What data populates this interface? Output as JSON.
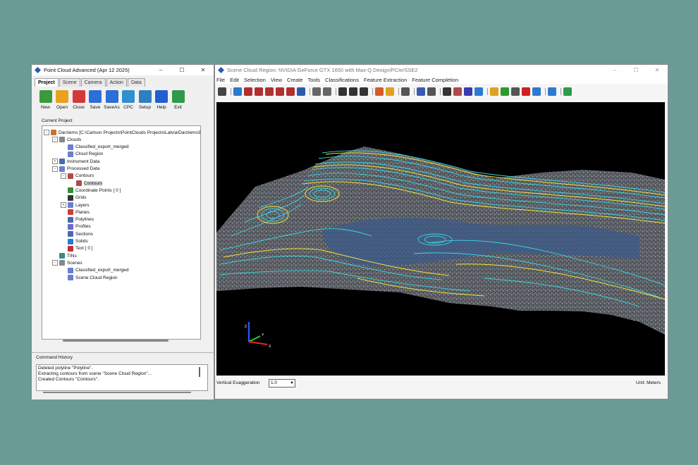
{
  "left_window": {
    "title": "Point Cloud Advanced (Apr 12 2025)",
    "controls": {
      "minimize": "–",
      "maximize": "☐",
      "close": "✕"
    },
    "tabs": [
      "Project",
      "Scene",
      "Camera",
      "Action",
      "Data"
    ],
    "toolbar": [
      {
        "label": "New",
        "icon": "new-icon",
        "color": "#3a9a3a"
      },
      {
        "label": "Open",
        "icon": "open-folder-icon",
        "color": "#e8a21e"
      },
      {
        "label": "Close",
        "icon": "close-doc-icon",
        "color": "#d23a3a"
      },
      {
        "label": "Save",
        "icon": "save-icon",
        "color": "#2c6fd6"
      },
      {
        "label": "SaveAs",
        "icon": "saveas-icon",
        "color": "#2c6fd6"
      },
      {
        "label": "CPC",
        "icon": "cpc-icon",
        "color": "#2f8fd0"
      },
      {
        "label": "Setup",
        "icon": "gear-icon",
        "color": "#2f7fc0"
      },
      {
        "label": "Help",
        "icon": "help-icon",
        "color": "#1f5fd0"
      },
      {
        "label": "Exit",
        "icon": "exit-icon",
        "color": "#2e9a4a"
      }
    ],
    "current_project_label": "Current Project",
    "tree": [
      {
        "label": "Darziems [C:\\Carlson Projects\\PointClouds Projects\\Latvia\\Darziems\\D",
        "exp": "⊟",
        "color": "#c8742a"
      },
      {
        "label": "Clouds",
        "exp": "⊟",
        "color": "#888"
      },
      {
        "label": "Classified_export_merged",
        "exp": "",
        "color": "#6a7fd0"
      },
      {
        "label": "Cloud Region",
        "exp": "",
        "color": "#6a7fd0"
      },
      {
        "label": "Instrument Data",
        "exp": "⊞",
        "color": "#4a6ab0"
      },
      {
        "label": "Processed Data",
        "exp": "⊟",
        "color": "#6a7fd0"
      },
      {
        "label": "Contours",
        "exp": "⊟",
        "color": "#b04a4a"
      },
      {
        "label": "Contours",
        "exp": "",
        "color": "#b04a4a"
      },
      {
        "label": "Coordinate Points [ 0 ]",
        "exp": "",
        "color": "#3a8a3a"
      },
      {
        "label": "Grids",
        "exp": "",
        "color": "#333"
      },
      {
        "label": "Layers",
        "exp": "⊞",
        "color": "#6a7fd0"
      },
      {
        "label": "Planes",
        "exp": "",
        "color": "#d23a3a"
      },
      {
        "label": "Polylines",
        "exp": "",
        "color": "#4a6ab0"
      },
      {
        "label": "Profiles",
        "exp": "",
        "color": "#6a6ad0"
      },
      {
        "label": "Sections",
        "exp": "",
        "color": "#4a6ab0"
      },
      {
        "label": "Solids",
        "exp": "",
        "color": "#2a7ad0"
      },
      {
        "label": "Text [ 0 ]",
        "exp": "",
        "color": "#c03030"
      },
      {
        "label": "TINs",
        "exp": "",
        "color": "#3a8a8a"
      },
      {
        "label": "Scenes",
        "exp": "⊟",
        "color": "#888"
      },
      {
        "label": "Classified_export_merged",
        "exp": "",
        "color": "#6a7fd0"
      },
      {
        "label": "Scene Cloud Region",
        "exp": "",
        "color": "#6a7fd0"
      }
    ],
    "command_history": {
      "header": "Command History",
      "lines": [
        "Deleted polyline \"Polyline\".",
        "Extracting contours from scene \"Scene Cloud Region\"...",
        "Created Contours \"Contours\"."
      ]
    }
  },
  "right_window": {
    "title": "Scene Cloud Region: NVIDIA GeForce GTX 1650 with Max-Q Design/PCIe/SSE2",
    "controls": {
      "minimize": "–",
      "maximize": "☐",
      "close": "✕"
    },
    "menu": [
      "File",
      "Edit",
      "Selection",
      "View",
      "Create",
      "Tools",
      "Classifications",
      "Feature Extraction",
      "Feature Completion"
    ],
    "axes": {
      "x": "X",
      "y": "Y",
      "z": "Z"
    },
    "vertical_exaggeration_label": "Vertical Exaggeration",
    "vertical_exaggeration_value": "1.0",
    "unit_label": "Unit: Meters"
  },
  "colors": {
    "background": "#6b9b95",
    "viewport": "#000000",
    "contour_cyan": "#3ad6e0",
    "contour_yellow": "#f2e23a"
  }
}
